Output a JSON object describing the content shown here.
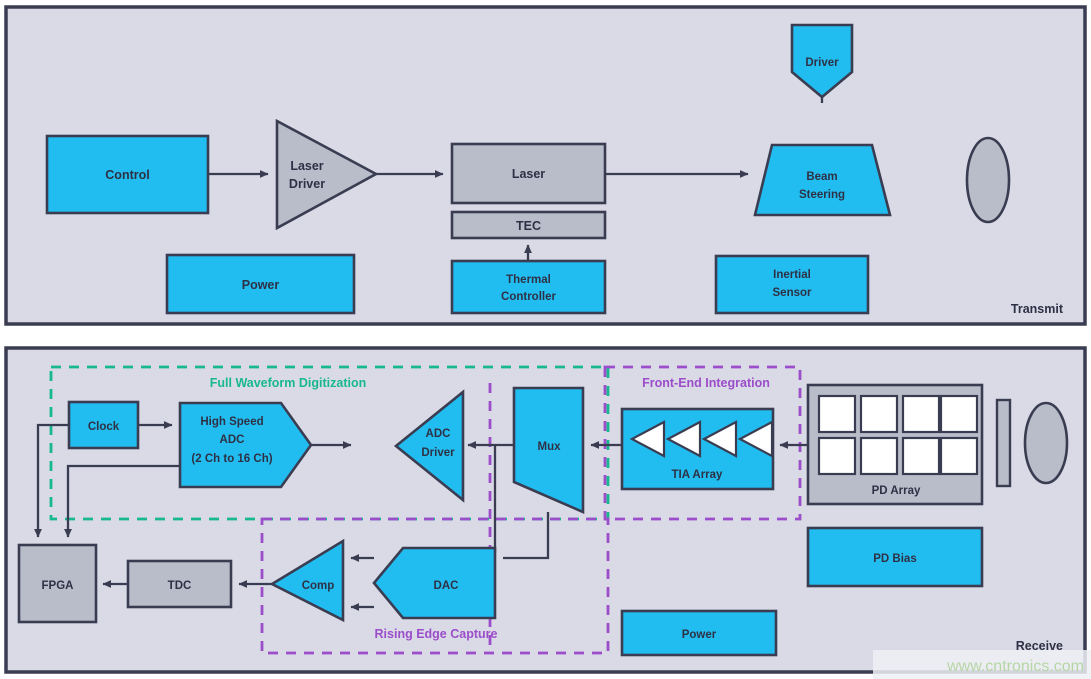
{
  "meta": {
    "colors": {
      "panel_fill": "#d9dae6",
      "panel_border": "#3a3d52",
      "cyan": "#22bdf0",
      "gray": "#b9bcc9",
      "stroke": "#3a3d52",
      "green_dash": "#17b890",
      "purple_dash": "#9b4dca",
      "white": "#ffffff",
      "watermark": "#b6d6a6"
    }
  },
  "transmit": {
    "panel_label": "Transmit",
    "blocks": {
      "control": "Control",
      "laser_driver_l1": "Laser",
      "laser_driver_l2": "Driver",
      "laser": "Laser",
      "tec": "TEC",
      "thermal_l1": "Thermal",
      "thermal_l2": "Controller",
      "power": "Power",
      "driver": "Driver",
      "beam_l1": "Beam",
      "beam_l2": "Steering",
      "inertial_l1": "Inertial",
      "inertial_l2": "Sensor",
      "lens": "tx-lens"
    }
  },
  "receive": {
    "panel_label": "Receive",
    "groups": {
      "full_waveform": "Full Waveform Digitization",
      "front_end": "Front-End Integration",
      "rising_edge": "Rising Edge Capture"
    },
    "blocks": {
      "clock": "Clock",
      "adc_l1": "High Speed",
      "adc_l2": "ADC",
      "adc_l3": "(2 Ch to 16 Ch)",
      "adc_driver_l1": "ADC",
      "adc_driver_l2": "Driver",
      "mux": "Mux",
      "tia": "TIA Array",
      "pd_array": "PD Array",
      "pd_bias": "PD Bias",
      "power": "Power",
      "fpga": "FPGA",
      "tdc": "TDC",
      "comp": "Comp",
      "dac": "DAC",
      "filter": "rx-filter",
      "lens": "rx-lens"
    }
  },
  "watermark": {
    "text": "www.cntronics.com"
  }
}
